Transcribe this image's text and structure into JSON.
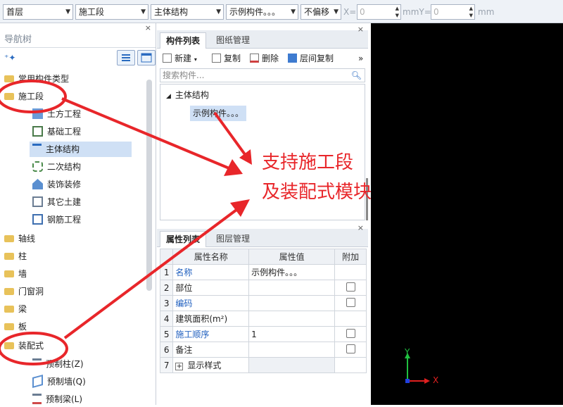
{
  "toolbar": {
    "floor": "首层",
    "stage": "施工段",
    "category": "主体结构",
    "component": "示例构件。。。",
    "offset": "不偏移",
    "x_label": "X=",
    "x_value": "0",
    "y_label": "mmY=",
    "y_value": "0",
    "unit": "mm"
  },
  "nav": {
    "title": "导航树",
    "close": "×",
    "items": [
      {
        "label": "常用构件类型"
      },
      {
        "label": "施工段"
      },
      {
        "label": "土方工程"
      },
      {
        "label": "基础工程"
      },
      {
        "label": "主体结构"
      },
      {
        "label": "二次结构"
      },
      {
        "label": "装饰装修"
      },
      {
        "label": "其它土建"
      },
      {
        "label": "钢筋工程"
      },
      {
        "label": "轴线"
      },
      {
        "label": "柱"
      },
      {
        "label": "墙"
      },
      {
        "label": "门窗洞"
      },
      {
        "label": "梁"
      },
      {
        "label": "板"
      },
      {
        "label": "装配式"
      },
      {
        "label": "预制柱(Z)"
      },
      {
        "label": "预制墙(Q)"
      },
      {
        "label": "预制梁(L)"
      }
    ]
  },
  "component_panel": {
    "tab_active": "构件列表",
    "tab_other": "图纸管理",
    "close": "×",
    "new": "新建",
    "copy": "复制",
    "delete": "删除",
    "floor_copy": "层间复制",
    "more": "»",
    "search_placeholder": "搜索构件...",
    "tree_root": "主体结构",
    "tree_child": "示例构件。。。"
  },
  "property_panel": {
    "tab_active": "属性列表",
    "tab_other": "图层管理",
    "close": "×",
    "headers": [
      "",
      "属性名称",
      "属性值",
      "附加"
    ],
    "rows": [
      {
        "num": "1",
        "name": "名称",
        "value": "示例构件。。。"
      },
      {
        "num": "2",
        "name": "部位",
        "value": ""
      },
      {
        "num": "3",
        "name": "编码",
        "value": ""
      },
      {
        "num": "4",
        "name": "建筑面积(m²)",
        "value": ""
      },
      {
        "num": "5",
        "name": "施工顺序",
        "value": "1"
      },
      {
        "num": "6",
        "name": "备注",
        "value": ""
      },
      {
        "num": "7",
        "name": "显示样式",
        "value": ""
      }
    ]
  },
  "canvas": {
    "axis_x": "X",
    "axis_y": "Y"
  },
  "annotation": {
    "line1": "支持施工段",
    "line2": "及装配式模块"
  },
  "colors": {
    "annotation_red": "#e8262a",
    "selection_blue": "#cfe0f5",
    "folder_yellow": "#e8c25a"
  }
}
